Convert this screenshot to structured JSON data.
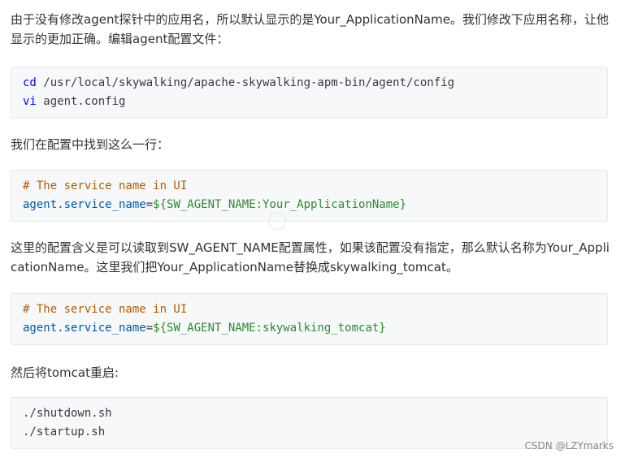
{
  "paragraphs": {
    "p1": "由于没有修改agent探针中的应用名，所以默认显示的是Your_ApplicationName。我们修改下应用名称，让他显示的更加正确。编辑agent配置文件：",
    "p2": "我们在配置中找到这么一行：",
    "p3": "这里的配置含义是可以读取到SW_AGENT_NAME配置属性，如果该配置没有指定，那么默认名称为Your_ApplicationName。这里我们把Your_ApplicationName替换成skywalking_tomcat。",
    "p4": "然后将tomcat重启:"
  },
  "code1": {
    "l1_kw": "cd",
    "l1_rest": " /usr/local/skywalking/apache-skywalking-apm-bin/agent/config",
    "l2_kw": "vi",
    "l2_rest": " agent.config"
  },
  "code2": {
    "comment": "# The service name in UI",
    "var": "agent.service_name",
    "eq": "=",
    "val": "${SW_AGENT_NAME:Your_ApplicationName}"
  },
  "code3": {
    "comment": "# The service name in UI",
    "var": "agent.service_name",
    "eq": "=",
    "val": "${SW_AGENT_NAME:skywalking_tomcat}"
  },
  "code4": {
    "l1": "./shutdown.sh",
    "l2": "./startup.sh"
  },
  "footer": "CSDN @LZYmarks",
  "colors": {
    "keyword": "#0000ff",
    "comment": "#b35c00",
    "variable": "#0058a8",
    "string": "#2e8b2e",
    "code_bg": "#f6f8fa"
  }
}
